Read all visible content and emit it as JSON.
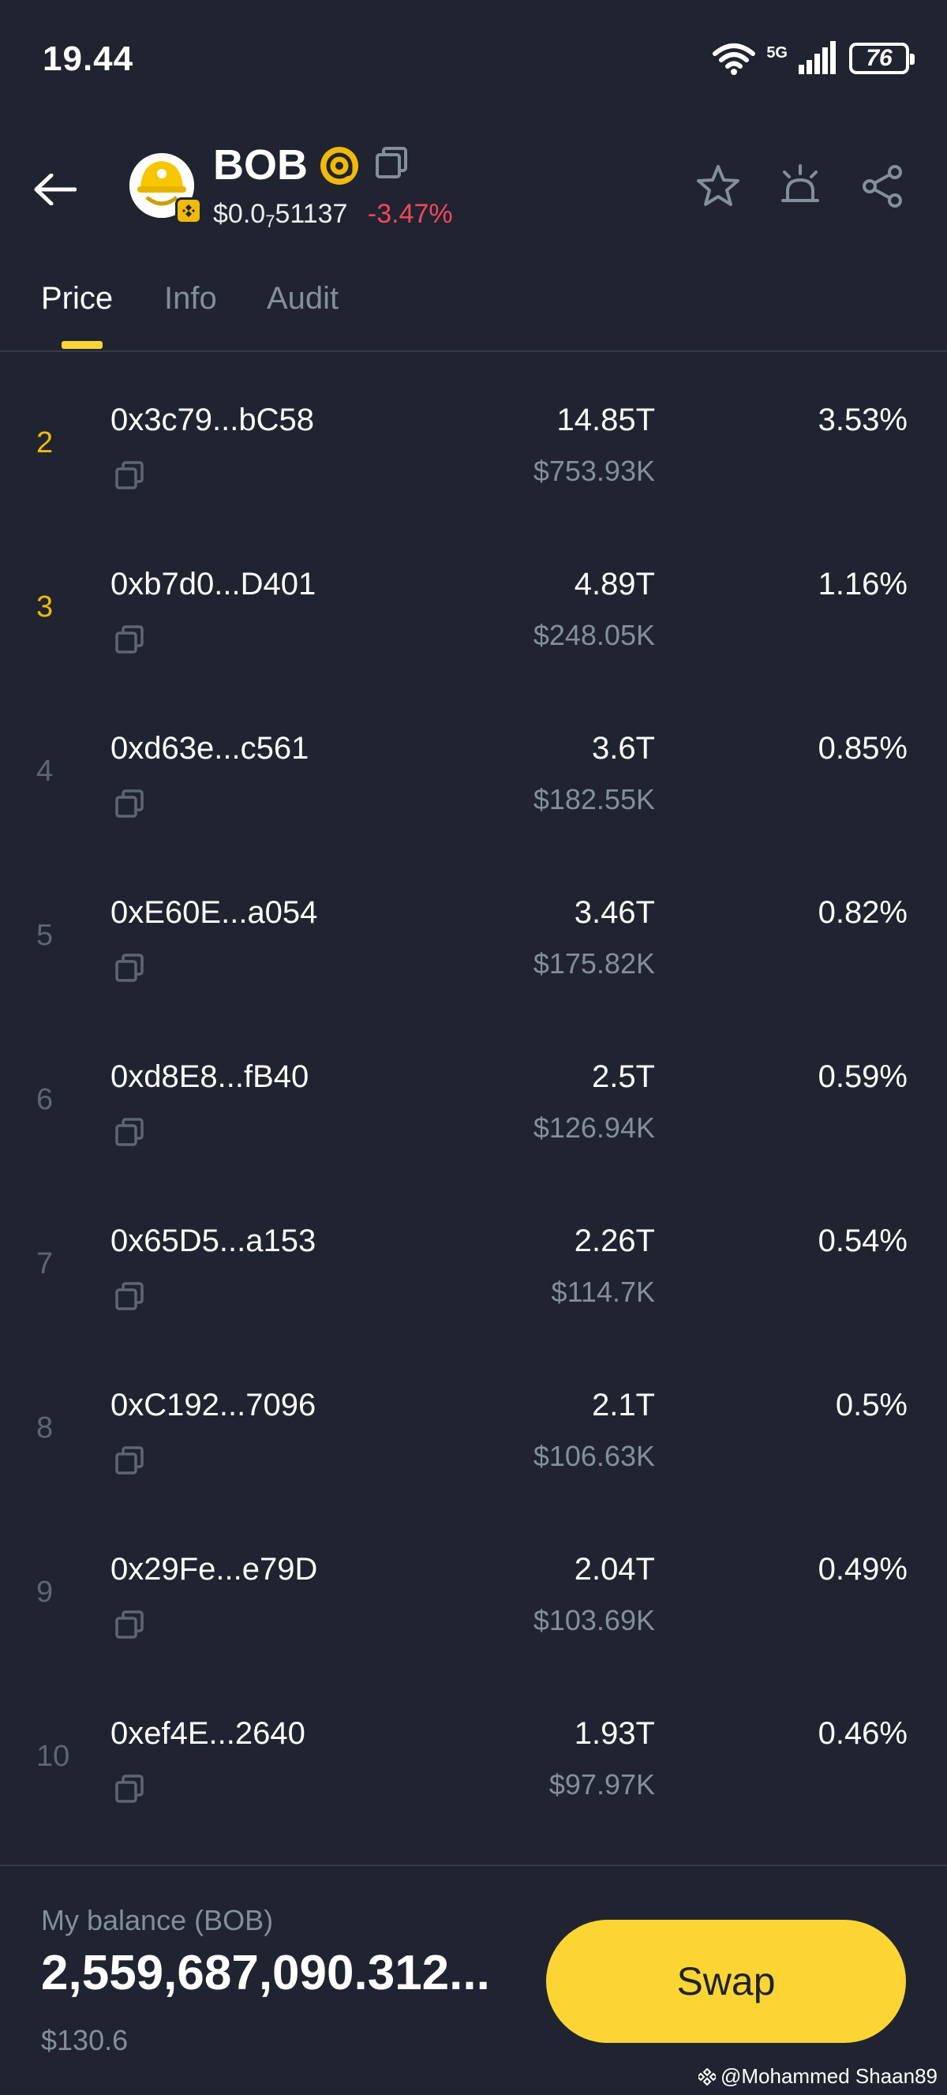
{
  "status_bar": {
    "time": "19.44",
    "network": "5G",
    "battery": "76"
  },
  "header": {
    "symbol": "BOB",
    "price_prefix": "$0.0",
    "price_subscript": "7",
    "price_digits": "51137",
    "change": "-3.47%"
  },
  "tabs": [
    {
      "label": "Price",
      "active": true
    },
    {
      "label": "Info",
      "active": false
    },
    {
      "label": "Audit",
      "active": false
    }
  ],
  "holders": [
    {
      "rank": "2",
      "address": "0x3c79...bC58",
      "amount": "14.85T",
      "usd": "$753.93K",
      "percent": "3.53%"
    },
    {
      "rank": "3",
      "address": "0xb7d0...D401",
      "amount": "4.89T",
      "usd": "$248.05K",
      "percent": "1.16%"
    },
    {
      "rank": "4",
      "address": "0xd63e...c561",
      "amount": "3.6T",
      "usd": "$182.55K",
      "percent": "0.85%"
    },
    {
      "rank": "5",
      "address": "0xE60E...a054",
      "amount": "3.46T",
      "usd": "$175.82K",
      "percent": "0.82%"
    },
    {
      "rank": "6",
      "address": "0xd8E8...fB40",
      "amount": "2.5T",
      "usd": "$126.94K",
      "percent": "0.59%"
    },
    {
      "rank": "7",
      "address": "0x65D5...a153",
      "amount": "2.26T",
      "usd": "$114.7K",
      "percent": "0.54%"
    },
    {
      "rank": "8",
      "address": "0xC192...7096",
      "amount": "2.1T",
      "usd": "$106.63K",
      "percent": "0.5%"
    },
    {
      "rank": "9",
      "address": "0x29Fe...e79D",
      "amount": "2.04T",
      "usd": "$103.69K",
      "percent": "0.49%"
    },
    {
      "rank": "10",
      "address": "0xef4E...2640",
      "amount": "1.93T",
      "usd": "$97.97K",
      "percent": "0.46%"
    }
  ],
  "bottom": {
    "balance_label": "My balance (BOB)",
    "balance_value": "2,559,687,090.312...",
    "balance_usd": "$130.6",
    "swap_label": "Swap"
  },
  "watermark": "@Mohammed Shaan89",
  "colors": {
    "background": "#1f2430",
    "accent": "#fcd535",
    "negative": "#f6465d",
    "muted": "#848e9c",
    "rank_top": "#f0b90b"
  },
  "icons": {
    "back": "arrow-left-icon",
    "favorite": "star-icon",
    "alert": "alarm-icon",
    "share": "share-icon",
    "copy": "copy-icon"
  }
}
